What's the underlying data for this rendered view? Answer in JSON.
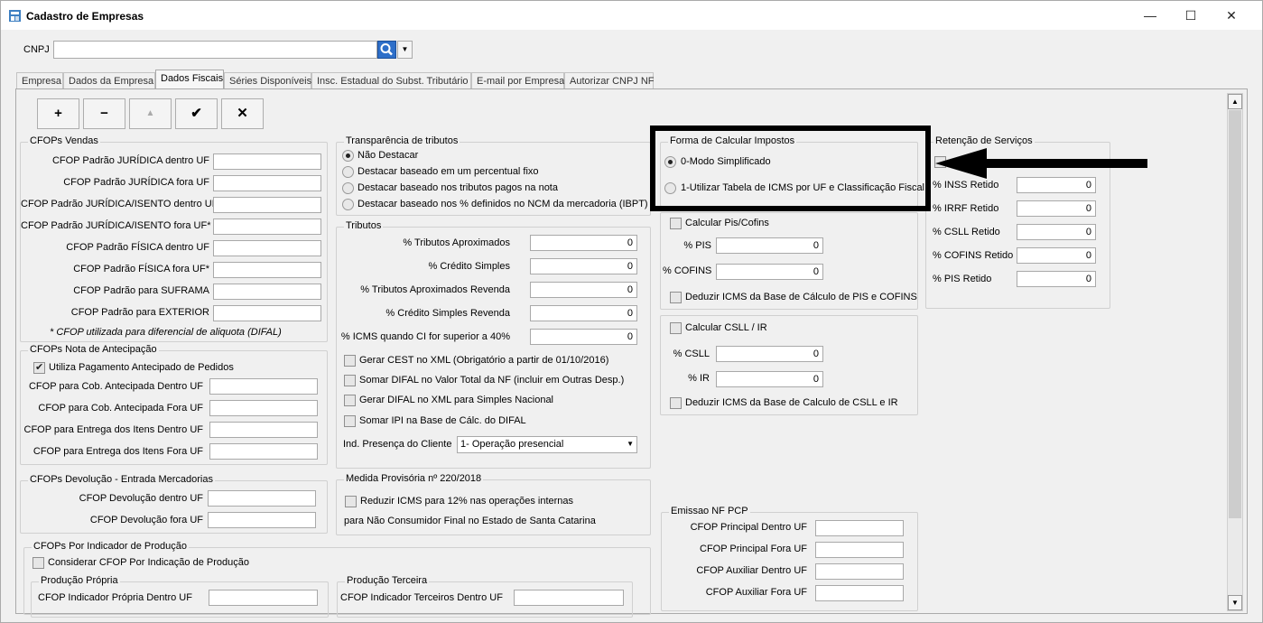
{
  "window": {
    "title": "Cadastro de Empresas",
    "min": "—",
    "max": "☐",
    "close": "✕"
  },
  "cnpj": {
    "label": "CNPJ",
    "value": ""
  },
  "tabs": [
    "Empresa",
    "Dados da Empresa",
    "Dados Fiscais",
    "Séries Disponíveis",
    "Insc. Estadual do Subst. Tributário",
    "E-mail por Empresa",
    "Autorizar CNPJ NF"
  ],
  "toolbar": {
    "add": "+",
    "remove": "−",
    "up": "▲",
    "confirm": "✔",
    "cancel": "✕"
  },
  "cfops_vendas": {
    "title": "CFOPs Vendas",
    "items": [
      "CFOP Padrão JURÍDICA dentro UF",
      "CFOP Padrão JURÍDICA fora UF",
      "CFOP Padrão JURÍDICA/ISENTO dentro UF",
      "CFOP Padrão JURÍDICA/ISENTO fora UF*",
      "CFOP Padrão FÍSICA dentro UF",
      "CFOP Padrão FÍSICA fora UF*",
      "CFOP Padrão para SUFRAMA",
      "CFOP Padrão para EXTERIOR"
    ],
    "note": "* CFOP utilizada para diferencial de aliquota (DIFAL)"
  },
  "cfops_antecipacao": {
    "title": "CFOPs Nota de Antecipação",
    "check": "Utiliza Pagamento Antecipado de Pedidos",
    "items": [
      "CFOP para Cob. Antecipada Dentro UF",
      "CFOP para Cob. Antecipada Fora UF",
      "CFOP para Entrega dos Itens Dentro UF",
      "CFOP para Entrega dos Itens Fora UF"
    ]
  },
  "cfops_devolucao": {
    "title": "CFOPs Devolução - Entrada Mercadorias",
    "items": [
      "CFOP Devolução dentro UF",
      "CFOP Devolução fora UF"
    ]
  },
  "cfops_producao": {
    "title": "CFOPs Por Indicador de Produção",
    "check": "Considerar CFOP Por Indicação de Produção",
    "propria_title": "Produção Própria",
    "propria_label": "CFOP Indicador Própria Dentro UF",
    "terceira_title": "Produção Terceira",
    "terceira_label": "CFOP Indicador Terceiros Dentro UF"
  },
  "transparencia": {
    "title": "Transparência de tributos",
    "options": [
      "Não Destacar",
      "Destacar baseado em um percentual fixo",
      "Destacar baseado nos tributos pagos na nota",
      "Destacar baseado nos % definidos no NCM da mercadoria (IBPT)"
    ]
  },
  "tributos": {
    "title": "Tributos",
    "fields": [
      {
        "label": "% Tributos Aproximados",
        "value": "0"
      },
      {
        "label": "% Crédito Simples",
        "value": "0"
      },
      {
        "label": "% Tributos Aproximados Revenda",
        "value": "0"
      },
      {
        "label": "% Crédito Simples Revenda",
        "value": "0"
      },
      {
        "label": "% ICMS quando CI for superior a 40%",
        "value": "0"
      }
    ],
    "checks": [
      "Gerar CEST no XML (Obrigatório a partir de 01/10/2016)",
      "Somar DIFAL no Valor Total da NF (incluir em Outras Desp.)",
      "Gerar DIFAL no XML para Simples Nacional",
      "Somar IPI na Base de Cálc. do DIFAL"
    ],
    "presenca_label": "Ind. Presença do Cliente",
    "presenca_value": "1- Operação presencial"
  },
  "medida": {
    "title": "Medida Provisória nº 220/2018",
    "check": "Reduzir ICMS para 12% nas operações internas",
    "text": "para Não Consumidor Final no Estado de Santa Catarina"
  },
  "forma": {
    "title": "Forma de Calcular Impostos",
    "options": [
      "0-Modo Simplificado",
      "1-Utilizar Tabela de ICMS por UF e Classificação Fiscal"
    ]
  },
  "pis": {
    "check": "Calcular Pis/Cofins",
    "pis_label": "% PIS",
    "pis_value": "0",
    "cofins_label": "% COFINS",
    "cofins_value": "0",
    "deduzir": "Deduzir ICMS da Base de Cálculo de PIS e COFINS"
  },
  "csll": {
    "check": "Calcular CSLL / IR",
    "csll_label": "% CSLL",
    "csll_value": "0",
    "ir_label": "% IR",
    "ir_value": "0",
    "deduzir": "Deduzir ICMS da Base de Calculo de CSLL e IR"
  },
  "retencao": {
    "title": "Retenção de Serviços",
    "fields": [
      {
        "label": "% INSS Retido",
        "value": "0"
      },
      {
        "label": "% IRRF Retido",
        "value": "0"
      },
      {
        "label": "% CSLL Retido",
        "value": "0"
      },
      {
        "label": "% COFINS Retido",
        "value": "0"
      },
      {
        "label": "% PIS Retido",
        "value": "0"
      }
    ]
  },
  "emissao": {
    "title": "Emissao NF PCP",
    "items": [
      "CFOP Principal Dentro UF",
      "CFOP Principal Fora UF",
      "CFOP Auxiliar Dentro UF",
      "CFOP Auxiliar Fora UF"
    ]
  }
}
